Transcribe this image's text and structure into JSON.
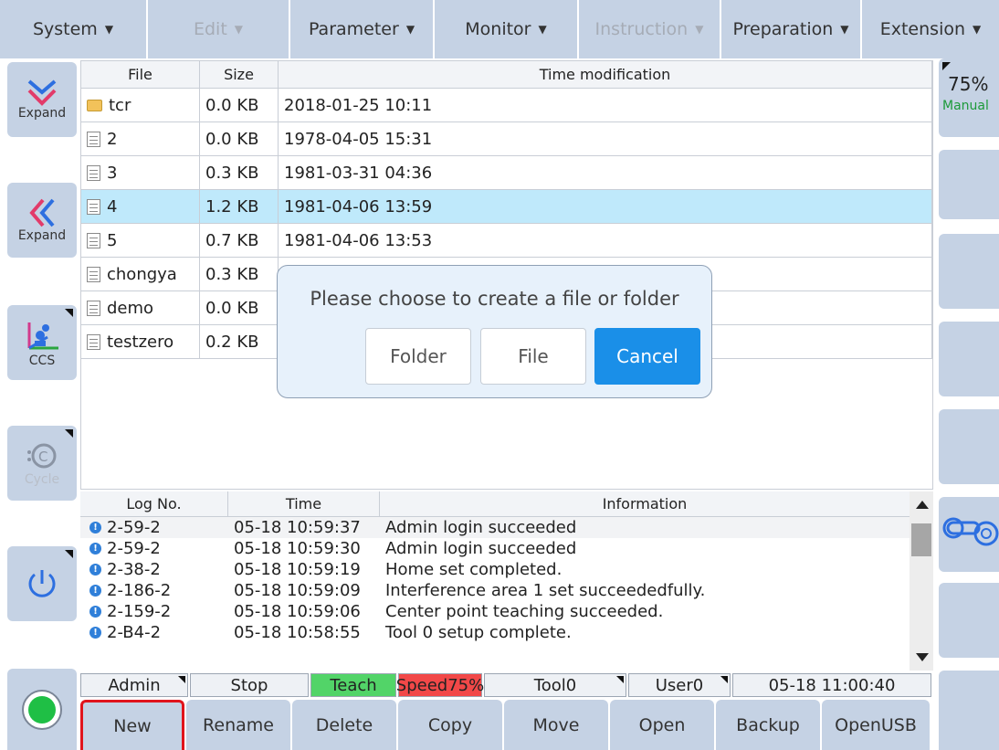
{
  "menu": [
    {
      "label": "System",
      "disabled": false
    },
    {
      "label": "Edit",
      "disabled": true
    },
    {
      "label": "Parameter",
      "disabled": false
    },
    {
      "label": "Monitor",
      "disabled": false
    },
    {
      "label": "Instruction",
      "disabled": true
    },
    {
      "label": "Preparation",
      "disabled": false
    },
    {
      "label": "Extension",
      "disabled": false
    }
  ],
  "leftrail": {
    "expand_down_label": "Expand",
    "expand_left_label": "Expand",
    "coord_label": "CCS",
    "cycle_label": "Cycle"
  },
  "rightrail": {
    "speed": "75%",
    "mode": "Manual"
  },
  "files": {
    "headers": [
      "File",
      "Size",
      "Time modification"
    ],
    "rows": [
      {
        "name": "tcr",
        "size": "0.0 KB",
        "time": "2018-01-25 10:11",
        "type": "folder"
      },
      {
        "name": "2",
        "size": "0.0 KB",
        "time": "1978-04-05 15:31",
        "type": "file"
      },
      {
        "name": "3",
        "size": "0.3 KB",
        "time": "1981-03-31 04:36",
        "type": "file"
      },
      {
        "name": "4",
        "size": "1.2 KB",
        "time": "1981-04-06 13:59",
        "type": "file"
      },
      {
        "name": "5",
        "size": "0.7 KB",
        "time": "1981-04-06 13:53",
        "type": "file"
      },
      {
        "name": "chongya",
        "size": "0.3 KB",
        "time": "",
        "type": "file"
      },
      {
        "name": "demo",
        "size": "0.0 KB",
        "time": "",
        "type": "file"
      },
      {
        "name": "testzero",
        "size": "0.2 KB",
        "time": "",
        "type": "file"
      }
    ]
  },
  "dialog": {
    "message": "Please choose to create a file or folder",
    "folder_label": "Folder",
    "file_label": "File",
    "cancel_label": "Cancel"
  },
  "logs": {
    "headers": [
      "Log No.",
      "Time",
      "Information"
    ],
    "rows": [
      {
        "no": "2-59-2",
        "time": "05-18 10:59:37",
        "info": "Admin  login succeeded"
      },
      {
        "no": "2-59-2",
        "time": "05-18 10:59:30",
        "info": "Admin  login succeeded"
      },
      {
        "no": "2-38-2",
        "time": "05-18 10:59:19",
        "info": "Home set completed."
      },
      {
        "no": "2-186-2",
        "time": "05-18 10:59:09",
        "info": "Interference area 1 set succeededfully."
      },
      {
        "no": "2-159-2",
        "time": "05-18 10:59:06",
        "info": "Center point teaching succeeded."
      },
      {
        "no": "2-B4-2",
        "time": "05-18 10:58:55",
        "info": "Tool 0 setup complete."
      }
    ]
  },
  "status": {
    "user": "Admin",
    "state": "Stop",
    "mode": "Teach",
    "speed": "Speed75%",
    "tool": "Tool0",
    "coord": "User0",
    "datetime": "05-18 11:00:40"
  },
  "toolbar": [
    "New",
    "Rename",
    "Delete",
    "Copy",
    "Move",
    "Open",
    "Backup",
    "OpenUSB"
  ],
  "colors": {
    "button_bg": "#c5d2e4",
    "selected_row": "#bfe9fb",
    "teach_green": "#52d468",
    "speed_red": "#f24848",
    "primary_blue": "#1a8fe8",
    "active_outline": "#e0141c"
  }
}
